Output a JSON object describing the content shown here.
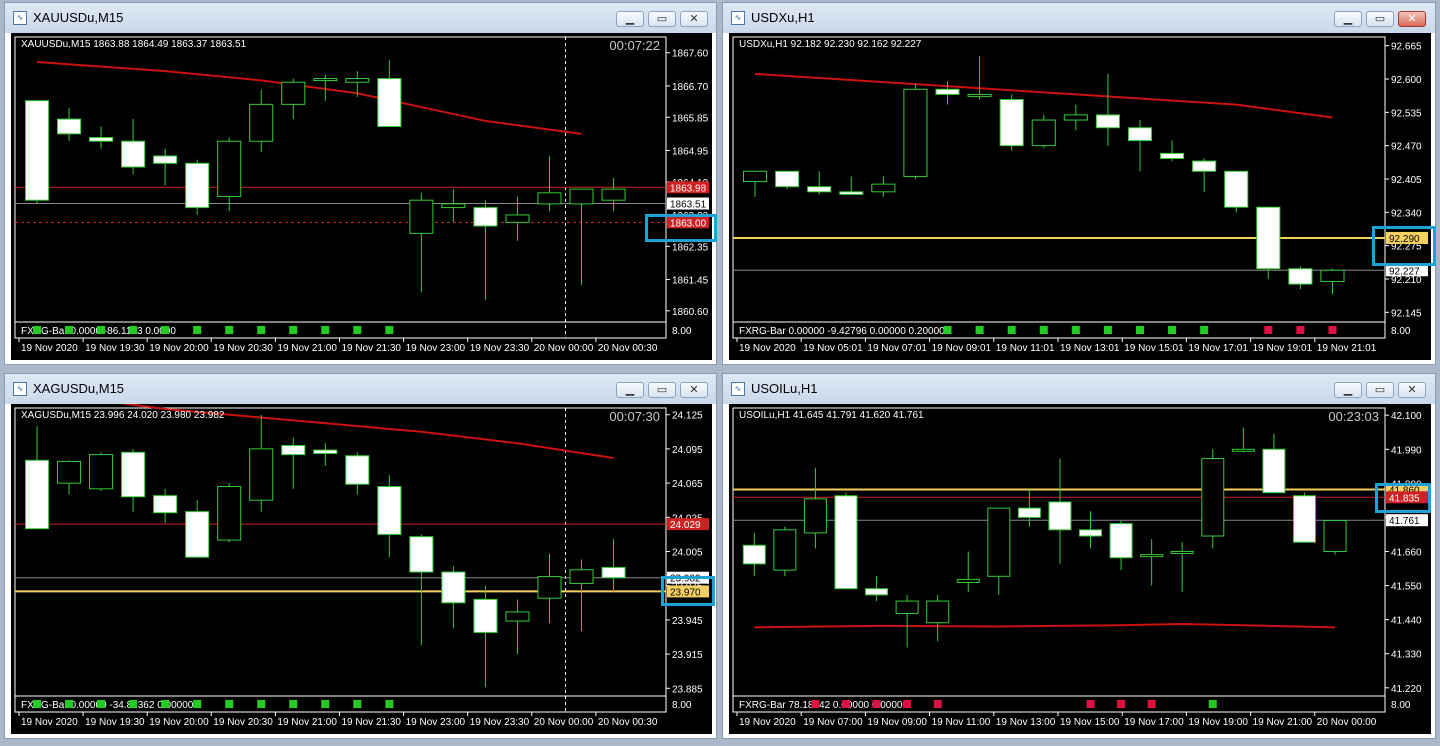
{
  "colors": {
    "background": "#000000",
    "foreground": "#ffffff",
    "grid": "#333333",
    "bull_body": "#000000",
    "bear_body": "#ffffff",
    "candle_outline": "#33cc33",
    "moving_average": "#cc1111",
    "bid_line": "#888888",
    "level_red": "#cc2222",
    "level_yellow": "#f5d060",
    "green_box": "#22cc22",
    "red_box": "#dd1144"
  },
  "windows": [
    {
      "title": "XAUUSDu,M15",
      "header": "XAUUSDu,M15  1863.88 1864.49 1863.37 1863.51",
      "timer": "00:07:22",
      "ymin": 1860.35,
      "ymax": 1868.0,
      "yticks": [
        "1867.60",
        "1866.70",
        "1865.85",
        "1864.95",
        "1864.10",
        "1863.20",
        "1862.35",
        "1861.45",
        "1860.60"
      ],
      "xlabels": [
        "19 Nov 2020",
        "19 Nov 19:30",
        "19 Nov 20:00",
        "19 Nov 20:30",
        "19 Nov 21:00",
        "19 Nov 21:30",
        "19 Nov 23:00",
        "19 Nov 23:30",
        "20 Nov 00:00",
        "20 Nov 00:30"
      ],
      "sep_index": 16,
      "candles": [
        [
          1866.3,
          1866.3,
          1863.5,
          1863.6
        ],
        [
          1865.8,
          1866.1,
          1865.2,
          1865.4
        ],
        [
          1865.3,
          1865.6,
          1865.0,
          1865.2
        ],
        [
          1865.2,
          1865.8,
          1864.3,
          1864.5
        ],
        [
          1864.8,
          1865.0,
          1864.0,
          1864.6
        ],
        [
          1864.6,
          1864.7,
          1863.2,
          1863.4
        ],
        [
          1863.7,
          1865.3,
          1863.3,
          1865.2
        ],
        [
          1865.2,
          1866.6,
          1864.9,
          1866.2
        ],
        [
          1866.2,
          1866.9,
          1865.8,
          1866.8
        ],
        [
          1866.9,
          1867.0,
          1866.3,
          1866.9
        ],
        [
          1866.8,
          1867.1,
          1866.4,
          1866.9
        ],
        [
          1866.9,
          1867.4,
          1865.7,
          1865.6
        ],
        [
          1862.7,
          1863.8,
          1861.1,
          1863.6
        ],
        [
          1863.4,
          1863.9,
          1863.0,
          1863.5
        ],
        [
          1863.4,
          1863.6,
          1860.9,
          1862.9
        ],
        [
          1863.0,
          1863.7,
          1862.5,
          1863.2
        ],
        [
          1863.5,
          1864.8,
          1863.3,
          1863.8
        ],
        [
          1863.5,
          1863.9,
          1861.3,
          1863.9
        ],
        [
          1863.6,
          1864.2,
          1863.3,
          1863.9
        ]
      ],
      "ma": [
        [
          0,
          1867.35
        ],
        [
          4,
          1867.1
        ],
        [
          7,
          1866.85
        ],
        [
          10,
          1866.5
        ],
        [
          14,
          1865.75
        ],
        [
          17,
          1865.4
        ]
      ],
      "levels": [
        {
          "value": 1863.95,
          "color": "red",
          "style": "solid",
          "label": "1863.98",
          "label_fill": "red"
        },
        {
          "value": 1863.51,
          "color": "gray",
          "style": "solid",
          "label": "1863.51",
          "label_fill": "white"
        },
        {
          "value": 1863.0,
          "color": "red",
          "style": "dashed",
          "label": "1863.00",
          "label_fill": "red"
        }
      ],
      "indicator_label": "FXRG-Bar 0.0000 -86.1133 0.0000",
      "indicator_top": "8.00",
      "boxes": [
        [
          "green",
          0
        ],
        [
          "green",
          1
        ],
        [
          "green",
          2
        ],
        [
          "green",
          3
        ],
        [
          "green",
          4
        ],
        [
          "green",
          5
        ],
        [
          "green",
          6
        ],
        [
          "green",
          7
        ],
        [
          "green",
          8
        ],
        [
          "green",
          9
        ],
        [
          "green",
          10
        ],
        [
          "green",
          11
        ]
      ],
      "highlight": "1863.00"
    },
    {
      "title": "USDXu,H1",
      "header": "USDXu,H1  92.182 92.230 92.162 92.227",
      "timer": "",
      "ymin": 92.13,
      "ymax": 92.68,
      "yticks": [
        "92.665",
        "92.600",
        "92.535",
        "92.470",
        "92.405",
        "92.340",
        "92.275",
        "92.210",
        "92.145"
      ],
      "xlabels": [
        "19 Nov 2020",
        "19 Nov 05:01",
        "19 Nov 07:01",
        "19 Nov 09:01",
        "19 Nov 11:01",
        "19 Nov 13:01",
        "19 Nov 15:01",
        "19 Nov 17:01",
        "19 Nov 19:01",
        "19 Nov 21:01"
      ],
      "sep_index": -1,
      "candles": [
        [
          92.4,
          92.42,
          92.37,
          92.42
        ],
        [
          92.42,
          92.42,
          92.385,
          92.39
        ],
        [
          92.39,
          92.42,
          92.375,
          92.38
        ],
        [
          92.38,
          92.41,
          92.375,
          92.375
        ],
        [
          92.38,
          92.41,
          92.37,
          92.395
        ],
        [
          92.41,
          92.59,
          92.405,
          92.58
        ],
        [
          92.58,
          92.595,
          92.55,
          92.57
        ],
        [
          92.57,
          92.645,
          92.56,
          92.57
        ],
        [
          92.56,
          92.57,
          92.46,
          92.47
        ],
        [
          92.47,
          92.53,
          92.465,
          92.52
        ],
        [
          92.52,
          92.55,
          92.5,
          92.53
        ],
        [
          92.53,
          92.61,
          92.47,
          92.505
        ],
        [
          92.505,
          92.52,
          92.42,
          92.48
        ],
        [
          92.455,
          92.48,
          92.44,
          92.445
        ],
        [
          92.44,
          92.445,
          92.38,
          92.42
        ],
        [
          92.42,
          92.42,
          92.34,
          92.35
        ],
        [
          92.35,
          92.35,
          92.21,
          92.23
        ],
        [
          92.23,
          92.235,
          92.19,
          92.2
        ],
        [
          92.205,
          92.23,
          92.18,
          92.227
        ]
      ],
      "ma": [
        [
          0,
          92.61
        ],
        [
          5,
          92.59
        ],
        [
          10,
          92.57
        ],
        [
          15,
          92.55
        ],
        [
          18,
          92.525
        ]
      ],
      "levels": [
        {
          "value": 92.29,
          "color": "yellow",
          "style": "solid",
          "label": "92.290",
          "label_fill": "yellow"
        },
        {
          "value": 92.227,
          "color": "gray",
          "style": "solid",
          "label": "92.227",
          "label_fill": "white"
        }
      ],
      "indicator_label": "FXRG-Bar 0.00000 -9.42796 0.00000 0.20000",
      "indicator_top": "8.00",
      "boxes": [
        [
          "green",
          6
        ],
        [
          "green",
          7
        ],
        [
          "green",
          8
        ],
        [
          "green",
          9
        ],
        [
          "green",
          10
        ],
        [
          "green",
          11
        ],
        [
          "green",
          12
        ],
        [
          "green",
          13
        ],
        [
          "green",
          14
        ],
        [
          "red",
          16
        ],
        [
          "red",
          17
        ],
        [
          "red",
          18
        ]
      ],
      "highlight": "92.290"
    },
    {
      "title": "XAGUSDu,M15",
      "header": "XAGUSDu,M15  23.996 24.020 23.980 23.982",
      "timer": "00:07:30",
      "ymin": 23.88,
      "ymax": 24.13,
      "yticks": [
        "24.125",
        "24.095",
        "24.065",
        "24.035",
        "24.005",
        "23.975",
        "23.945",
        "23.915",
        "23.885"
      ],
      "xlabels": [
        "19 Nov 2020",
        "19 Nov 19:30",
        "19 Nov 20:00",
        "19 Nov 20:30",
        "19 Nov 21:00",
        "19 Nov 21:30",
        "19 Nov 23:00",
        "19 Nov 23:30",
        "20 Nov 00:00",
        "20 Nov 00:30"
      ],
      "sep_index": 16,
      "candles": [
        [
          24.085,
          24.115,
          24.025,
          24.025
        ],
        [
          24.065,
          24.085,
          24.055,
          24.084
        ],
        [
          24.06,
          24.092,
          24.058,
          24.09
        ],
        [
          24.092,
          24.095,
          24.04,
          24.053
        ],
        [
          24.054,
          24.06,
          24.03,
          24.039
        ],
        [
          24.04,
          24.05,
          24.0,
          24.0
        ],
        [
          24.015,
          24.065,
          24.013,
          24.062
        ],
        [
          24.05,
          24.125,
          24.04,
          24.095
        ],
        [
          24.098,
          24.105,
          24.06,
          24.09
        ],
        [
          24.094,
          24.1,
          24.08,
          24.091
        ],
        [
          24.089,
          24.092,
          24.055,
          24.064
        ],
        [
          24.062,
          24.072,
          24.0,
          24.02
        ],
        [
          24.018,
          24.02,
          23.923,
          23.987
        ],
        [
          23.987,
          23.992,
          23.938,
          23.96
        ],
        [
          23.963,
          23.975,
          23.886,
          23.934
        ],
        [
          23.944,
          23.963,
          23.915,
          23.952
        ],
        [
          23.964,
          24.003,
          23.942,
          23.983
        ],
        [
          23.977,
          23.998,
          23.935,
          23.989
        ],
        [
          23.991,
          24.016,
          23.97,
          23.982
        ]
      ],
      "ma": [
        [
          0,
          24.145
        ],
        [
          4,
          24.13
        ],
        [
          8,
          24.12
        ],
        [
          12,
          24.11
        ],
        [
          15,
          24.1
        ],
        [
          18,
          24.087
        ]
      ],
      "levels": [
        {
          "value": 24.029,
          "color": "red",
          "style": "solid",
          "label": "24.029",
          "label_fill": "red"
        },
        {
          "value": 23.982,
          "color": "gray",
          "style": "solid",
          "label": "23.982",
          "label_fill": "white"
        },
        {
          "value": 23.97,
          "color": "yellow",
          "style": "solid",
          "label": "23.970",
          "label_fill": "yellow"
        }
      ],
      "indicator_label": "FXRG-Bar 0.00000 -34.81362 0.00000",
      "indicator_top": "8.00",
      "boxes": [
        [
          "green",
          0
        ],
        [
          "green",
          1
        ],
        [
          "green",
          2
        ],
        [
          "green",
          3
        ],
        [
          "green",
          4
        ],
        [
          "green",
          5
        ],
        [
          "green",
          6
        ],
        [
          "green",
          7
        ],
        [
          "green",
          8
        ],
        [
          "green",
          9
        ],
        [
          "green",
          10
        ],
        [
          "green",
          11
        ]
      ],
      "highlight": "23.970"
    },
    {
      "title": "USOILu,H1",
      "header": "USOILu,H1  41.645 41.791 41.620 41.761",
      "timer": "00:23:03",
      "ymin": 41.2,
      "ymax": 42.12,
      "yticks": [
        "42.100",
        "41.990",
        "41.880",
        "41.770",
        "41.660",
        "41.550",
        "41.440",
        "41.330",
        "41.220"
      ],
      "xlabels": [
        "19 Nov 2020",
        "19 Nov 07:00",
        "19 Nov 09:00",
        "19 Nov 11:00",
        "19 Nov 13:00",
        "19 Nov 15:00",
        "19 Nov 17:00",
        "19 Nov 19:00",
        "19 Nov 21:00",
        "20 Nov 00:00"
      ],
      "sep_index": -1,
      "candles": [
        [
          41.68,
          41.72,
          41.58,
          41.62
        ],
        [
          41.6,
          41.74,
          41.58,
          41.73
        ],
        [
          41.72,
          41.93,
          41.67,
          41.83
        ],
        [
          41.84,
          41.85,
          41.54,
          41.54
        ],
        [
          41.54,
          41.58,
          41.5,
          41.52
        ],
        [
          41.46,
          41.52,
          41.35,
          41.5
        ],
        [
          41.43,
          41.52,
          41.37,
          41.5
        ],
        [
          41.56,
          41.66,
          41.53,
          41.57
        ],
        [
          41.58,
          41.79,
          41.52,
          41.8
        ],
        [
          41.8,
          41.86,
          41.74,
          41.77
        ],
        [
          41.82,
          41.96,
          41.62,
          41.73
        ],
        [
          41.73,
          41.79,
          41.67,
          41.71
        ],
        [
          41.75,
          41.76,
          41.6,
          41.64
        ],
        [
          41.65,
          41.7,
          41.55,
          41.65
        ],
        [
          41.66,
          41.69,
          41.53,
          41.66
        ],
        [
          41.71,
          41.99,
          41.67,
          41.96
        ],
        [
          41.99,
          42.06,
          41.98,
          41.99
        ],
        [
          41.99,
          42.04,
          41.85,
          41.85
        ],
        [
          41.84,
          41.85,
          41.71,
          41.69
        ],
        [
          41.66,
          41.76,
          41.65,
          41.76
        ]
      ],
      "ma": [
        [
          0,
          41.415
        ],
        [
          4,
          41.42
        ],
        [
          8,
          41.418
        ],
        [
          12,
          41.422
        ],
        [
          14,
          41.426
        ],
        [
          16,
          41.422
        ],
        [
          19,
          41.415
        ]
      ],
      "levels": [
        {
          "value": 41.86,
          "color": "yellow",
          "style": "solid",
          "label": "41.860",
          "label_fill": "yellow"
        },
        {
          "value": 41.835,
          "color": "red",
          "style": "solid",
          "label": "41.835",
          "label_fill": "red"
        },
        {
          "value": 41.761,
          "color": "gray",
          "style": "solid",
          "label": "41.761",
          "label_fill": "white"
        }
      ],
      "indicator_label": "FXRG-Bar 78.18542 0.00000 0.00000",
      "indicator_top": "8.00",
      "boxes": [
        [
          "red",
          2
        ],
        [
          "red",
          3
        ],
        [
          "red",
          4
        ],
        [
          "red",
          5
        ],
        [
          "red",
          6
        ],
        [
          "red",
          11
        ],
        [
          "red",
          12
        ],
        [
          "red",
          13
        ],
        [
          "green",
          15
        ]
      ],
      "highlight": "41.860"
    }
  ]
}
